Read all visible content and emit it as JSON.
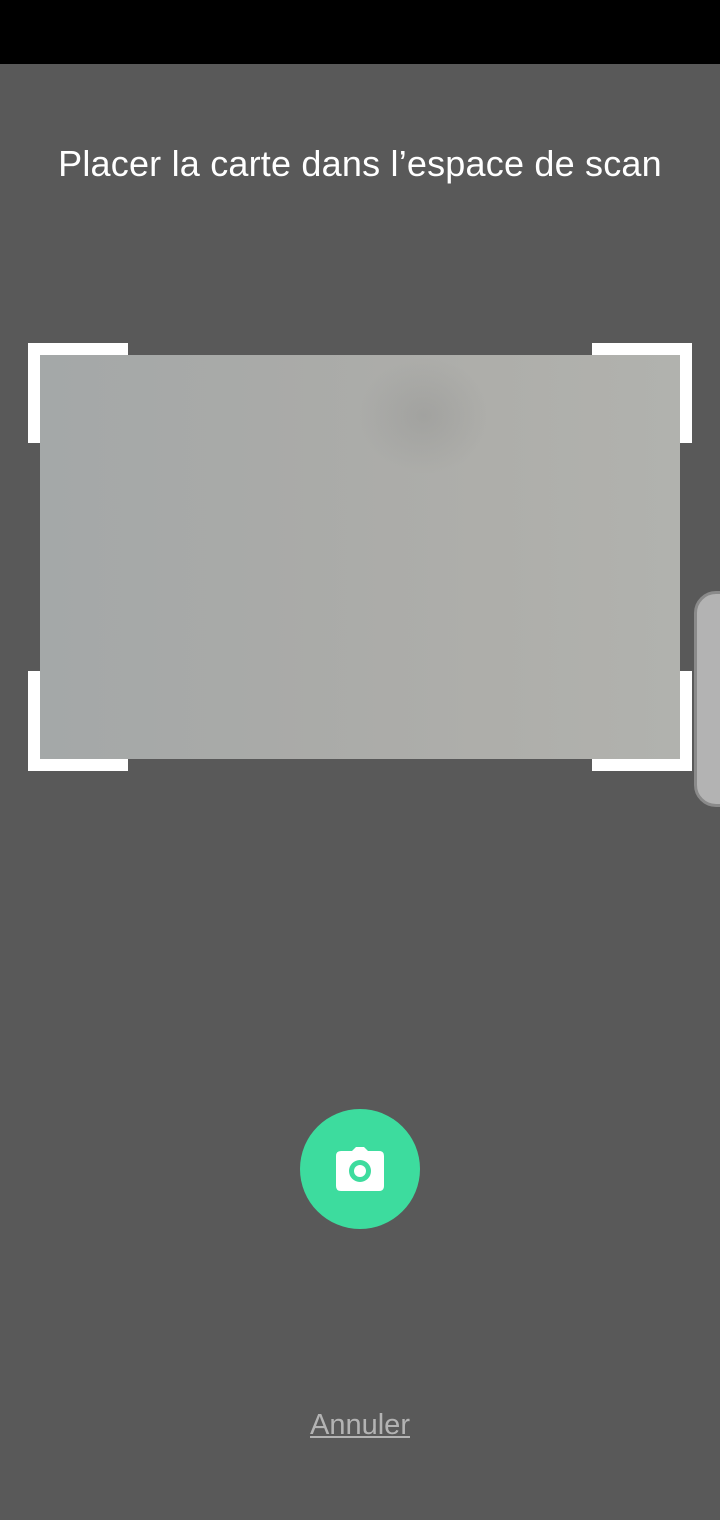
{
  "screen": {
    "title": "Placer la carte dans l’espace de scan"
  },
  "capture": {
    "icon": "camera-icon",
    "color": "#3ddc9e"
  },
  "actions": {
    "cancel_label": "Annuler"
  },
  "colors": {
    "background": "#595959",
    "status_bar": "#000000",
    "frame": "#ffffff"
  }
}
